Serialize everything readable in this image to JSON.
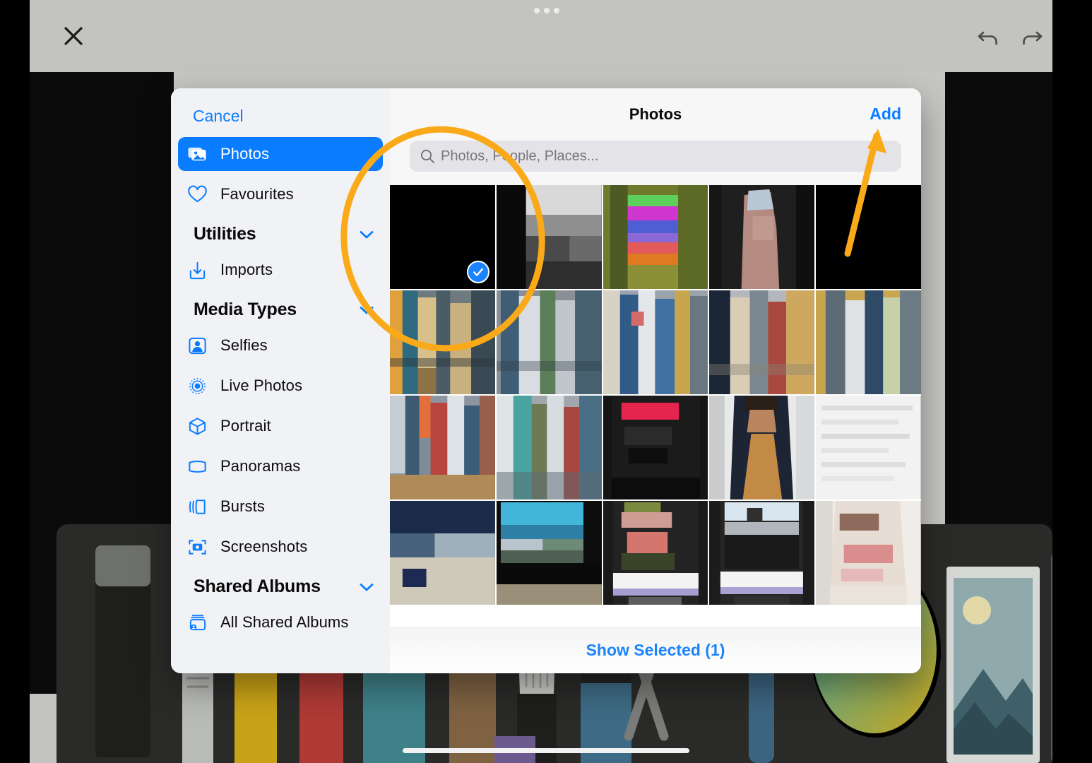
{
  "app": {
    "background_color": "#c3c4c0",
    "canvas_color": "#0b0b0b",
    "toolbar": {
      "close_icon": "close-icon",
      "undo_icon": "undo-icon",
      "redo_icon": "redo-icon",
      "drag_handle_icon": "drag-handle-dots-icon"
    },
    "tool_tray_color": "#2a2b29"
  },
  "annotation": {
    "color": "#FAA919",
    "shapes": [
      "ellipse-highlight",
      "arrow-pointer"
    ]
  },
  "picker": {
    "sidebar": {
      "cancel_label": "Cancel",
      "items": [
        {
          "label": "Photos",
          "icon": "photos-stack-icon",
          "active": true
        },
        {
          "label": "Favourites",
          "icon": "heart-icon",
          "active": false
        }
      ],
      "sections": [
        {
          "title": "Utilities",
          "chevron_icon": "chevron-down-icon",
          "items": [
            {
              "label": "Imports",
              "icon": "import-download-icon"
            }
          ]
        },
        {
          "title": "Media Types",
          "chevron_icon": "chevron-down-icon",
          "items": [
            {
              "label": "Selfies",
              "icon": "person-portrait-icon"
            },
            {
              "label": "Live Photos",
              "icon": "live-photo-icon"
            },
            {
              "label": "Portrait",
              "icon": "cube-icon"
            },
            {
              "label": "Panoramas",
              "icon": "panorama-icon"
            },
            {
              "label": "Bursts",
              "icon": "bursts-stack-icon"
            },
            {
              "label": "Screenshots",
              "icon": "screenshot-camera-icon"
            }
          ]
        },
        {
          "title": "Shared Albums",
          "chevron_icon": "chevron-down-icon",
          "items": [
            {
              "label": "All Shared Albums",
              "icon": "shared-album-icon"
            }
          ]
        }
      ]
    },
    "header": {
      "title": "Photos",
      "add_label": "Add"
    },
    "search": {
      "placeholder": "Photos, People, Places...",
      "value": "",
      "icon": "search-icon"
    },
    "footer": {
      "show_selected_label": "Show Selected (1)"
    },
    "grid": {
      "selected_count": 1,
      "check_icon": "checkmark-circle-icon",
      "cells": [
        {
          "selected": true,
          "style": "black"
        },
        {
          "selected": false,
          "style": "greyscreen"
        },
        {
          "selected": false,
          "style": "colorbars"
        },
        {
          "selected": false,
          "style": "portrait-dark"
        },
        {
          "selected": false,
          "style": "black"
        },
        {
          "selected": false,
          "style": "shelf-a"
        },
        {
          "selected": false,
          "style": "shelf-b"
        },
        {
          "selected": false,
          "style": "shelf-c"
        },
        {
          "selected": false,
          "style": "shelf-d"
        },
        {
          "selected": false,
          "style": "shelf-e"
        },
        {
          "selected": false,
          "style": "clutter-a"
        },
        {
          "selected": false,
          "style": "clutter-b"
        },
        {
          "selected": false,
          "style": "screen-red"
        },
        {
          "selected": false,
          "style": "person-suit"
        },
        {
          "selected": false,
          "style": "document-white"
        },
        {
          "selected": false,
          "style": "blue-room"
        },
        {
          "selected": false,
          "style": "monitor-blue"
        },
        {
          "selected": false,
          "style": "phone-dark"
        },
        {
          "selected": false,
          "style": "phone-light"
        },
        {
          "selected": false,
          "style": "fabric-pink"
        }
      ]
    }
  }
}
